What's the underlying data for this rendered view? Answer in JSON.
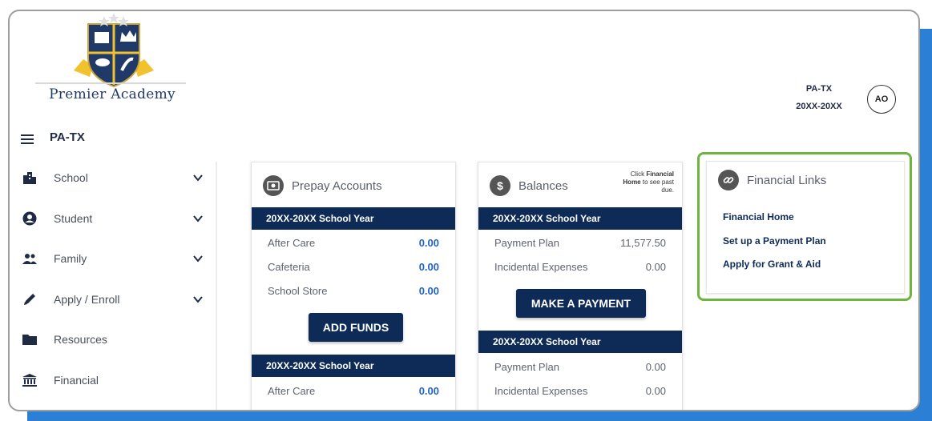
{
  "brand": {
    "name": "Premier Academy"
  },
  "user": {
    "org": "PA-TX",
    "year": "20XX-20XX",
    "initials": "AO"
  },
  "nav": {
    "title": "PA-TX",
    "items": [
      {
        "label": "School",
        "icon": "building-icon",
        "expandable": true
      },
      {
        "label": "Student",
        "icon": "user-circle-icon",
        "expandable": true
      },
      {
        "label": "Family",
        "icon": "people-icon",
        "expandable": true
      },
      {
        "label": "Apply / Enroll",
        "icon": "pencil-icon",
        "expandable": true
      },
      {
        "label": "Resources",
        "icon": "folder-icon",
        "expandable": false
      },
      {
        "label": "Financial",
        "icon": "bank-icon",
        "expandable": false
      }
    ]
  },
  "prepay": {
    "title": "Prepay Accounts",
    "year1": {
      "label": "20XX-20XX School Year",
      "rows": [
        {
          "label": "After Care",
          "value": "0.00"
        },
        {
          "label": "Cafeteria",
          "value": "0.00"
        },
        {
          "label": "School Store",
          "value": "0.00"
        }
      ]
    },
    "add_funds_label": "ADD FUNDS",
    "year2": {
      "label": "20XX-20XX School Year",
      "rows": [
        {
          "label": "After Care",
          "value": "0.00"
        }
      ]
    }
  },
  "balances": {
    "title": "Balances",
    "note_pre": "Click ",
    "note_link": "Financial Home",
    "note_post": " to see past due.",
    "year1": {
      "label": "20XX-20XX School Year",
      "rows": [
        {
          "label": "Payment Plan",
          "value": "11,577.50"
        },
        {
          "label": "Incidental Expenses",
          "value": "0.00"
        }
      ]
    },
    "make_payment_label": "MAKE A PAYMENT",
    "year2": {
      "label": "20XX-20XX School Year",
      "rows": [
        {
          "label": "Payment Plan",
          "value": "0.00"
        },
        {
          "label": "Incidental Expenses",
          "value": "0.00"
        }
      ]
    }
  },
  "financial_links": {
    "title": "Financial Links",
    "links": [
      {
        "label": "Financial Home"
      },
      {
        "label": "Set up a Payment Plan"
      },
      {
        "label": "Apply for Grant & Aid"
      }
    ]
  },
  "colors": {
    "navy": "#0e2b57",
    "accent_blue": "#2b7fd4",
    "highlight_green": "#6fb43f",
    "value_blue": "#1f63c9"
  }
}
